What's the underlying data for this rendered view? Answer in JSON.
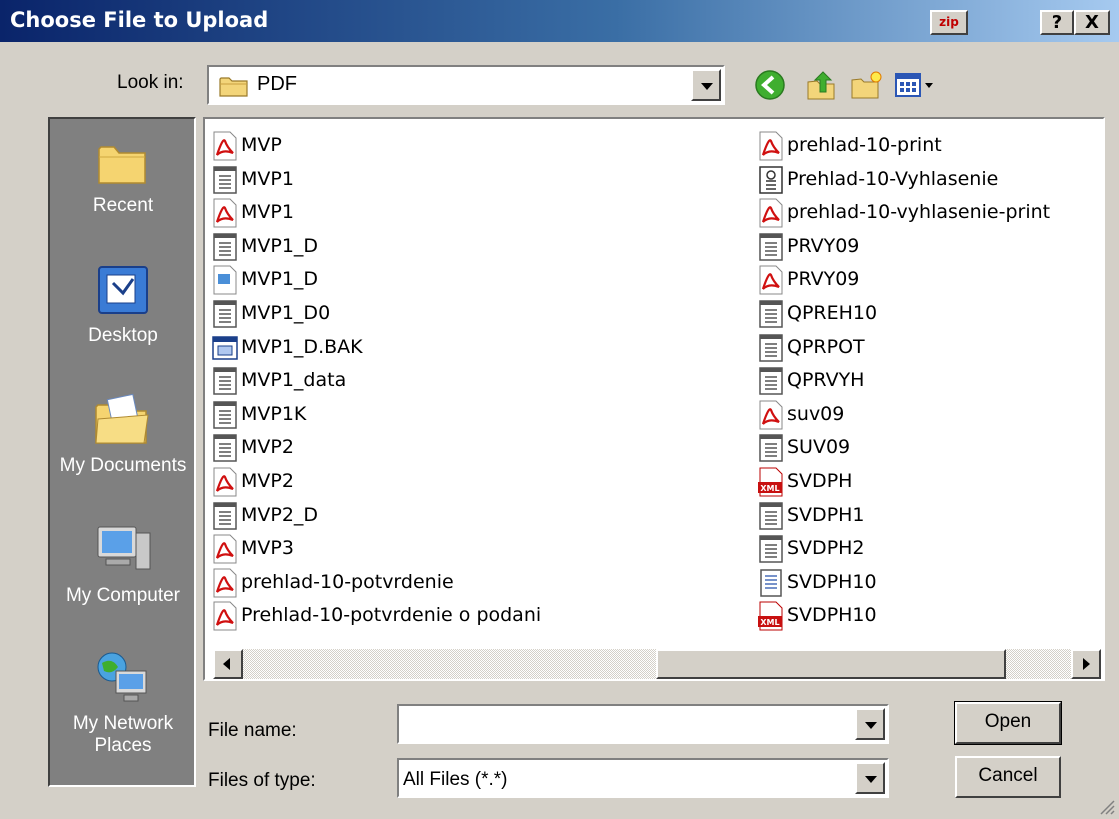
{
  "window": {
    "title": "Choose File to Upload",
    "zip_label": "zip",
    "help_label": "?",
    "close_label": "X"
  },
  "lookin": {
    "label": "Look in:",
    "value": "PDF"
  },
  "places": [
    {
      "label": "Recent",
      "icon": "recent-folder-icon"
    },
    {
      "label": "Desktop",
      "icon": "desktop-icon"
    },
    {
      "label": "My Documents",
      "icon": "my-documents-icon"
    },
    {
      "label": "My Computer",
      "icon": "my-computer-icon"
    },
    {
      "label": "My Network Places",
      "icon": "my-network-places-icon"
    }
  ],
  "files_col1": [
    {
      "name": "MVP",
      "type": "pdf"
    },
    {
      "name": "MVP1",
      "type": "text"
    },
    {
      "name": "MVP1",
      "type": "pdf"
    },
    {
      "name": "MVP1_D",
      "type": "text"
    },
    {
      "name": "MVP1_D",
      "type": "image"
    },
    {
      "name": "MVP1_D0",
      "type": "text"
    },
    {
      "name": "MVP1_D.BAK",
      "type": "bak"
    },
    {
      "name": "MVP1_data",
      "type": "text"
    },
    {
      "name": "MVP1K",
      "type": "text"
    },
    {
      "name": "MVP2",
      "type": "text"
    },
    {
      "name": "MVP2",
      "type": "pdf"
    },
    {
      "name": "MVP2_D",
      "type": "text"
    },
    {
      "name": "MVP3",
      "type": "pdf"
    },
    {
      "name": "prehlad-10-potvrdenie",
      "type": "pdf"
    },
    {
      "name": "Prehlad-10-potvrdenie o podani",
      "type": "pdf"
    }
  ],
  "files_col2": [
    {
      "name": "prehlad-10-print",
      "type": "pdf"
    },
    {
      "name": "Prehlad-10-Vyhlasenie",
      "type": "form"
    },
    {
      "name": "prehlad-10-vyhlasenie-print",
      "type": "pdf"
    },
    {
      "name": "PRVY09",
      "type": "text"
    },
    {
      "name": "PRVY09",
      "type": "pdf"
    },
    {
      "name": "QPREH10",
      "type": "text"
    },
    {
      "name": "QPRPOT",
      "type": "text"
    },
    {
      "name": "QPRVYH",
      "type": "text"
    },
    {
      "name": "suv09",
      "type": "pdf"
    },
    {
      "name": "SUV09",
      "type": "text"
    },
    {
      "name": "SVDPH",
      "type": "xml"
    },
    {
      "name": "SVDPH1",
      "type": "text"
    },
    {
      "name": "SVDPH2",
      "type": "text"
    },
    {
      "name": "SVDPH10",
      "type": "notepad"
    },
    {
      "name": "SVDPH10",
      "type": "xml"
    }
  ],
  "filename": {
    "label": "File name:",
    "value": ""
  },
  "filetype": {
    "label": "Files of type:",
    "value": "All Files (*.*)"
  },
  "buttons": {
    "open": "Open",
    "cancel": "Cancel"
  }
}
